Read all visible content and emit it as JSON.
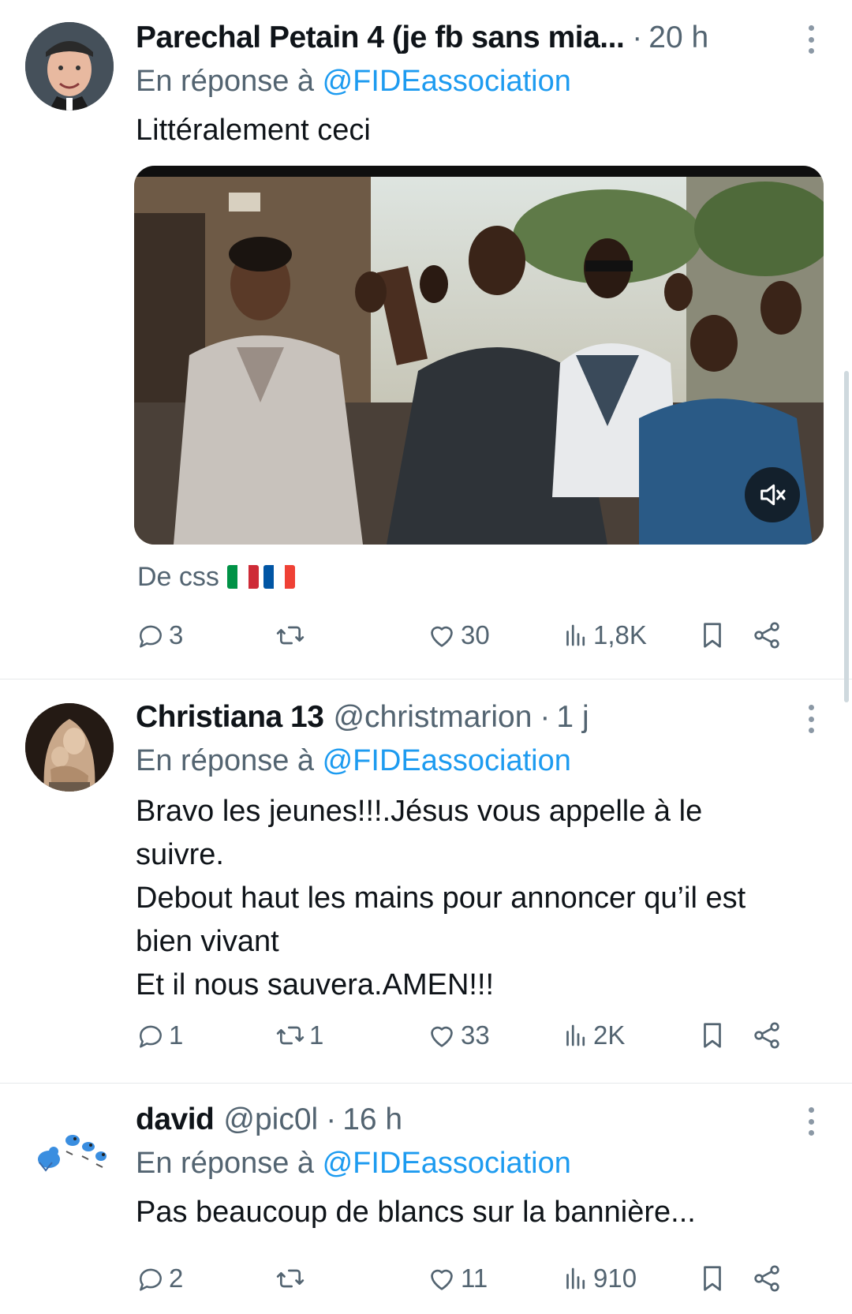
{
  "tweets": [
    {
      "name": "Parechal Petain 4 (je fb sans mia...",
      "handle": "",
      "time": "20 h",
      "reply_prefix": "En réponse à ",
      "reply_mention": "@FIDEassociation",
      "text_lines": [
        "Littéralement ceci"
      ],
      "media": {
        "type": "video",
        "muted_icon": "volume-mute-icon"
      },
      "caption": "De css",
      "caption_flags": [
        "italy-flag",
        "france-flag"
      ],
      "stats": {
        "replies": "3",
        "retweets": "",
        "likes": "30",
        "views": "1,8K"
      }
    },
    {
      "name": "Christiana 13",
      "handle": "@christmarion",
      "time": "1 j",
      "reply_prefix": "En réponse à ",
      "reply_mention": "@FIDEassociation",
      "text_lines": [
        "Bravo les jeunes!!!.Jésus vous appelle  à le",
        "suivre.",
        "Debout haut les mains pour annoncer qu’il est",
        "bien vivant",
        "Et il nous sauvera.AMEN!!!"
      ],
      "stats": {
        "replies": "1",
        "retweets": "1",
        "likes": "33",
        "views": "2K"
      }
    },
    {
      "name": "david",
      "handle": "@pic0l",
      "time": "16 h",
      "reply_prefix": "En réponse à ",
      "reply_mention": "@FIDEassociation",
      "text_lines": [
        "Pas beaucoup de blancs sur la bannière..."
      ],
      "stats": {
        "replies": "2",
        "retweets": "",
        "likes": "11",
        "views": "910"
      }
    }
  ],
  "colors": {
    "text": "#0f1419",
    "secondary": "#536471",
    "link": "#1d9bf0",
    "divider": "#e6e9eb"
  }
}
